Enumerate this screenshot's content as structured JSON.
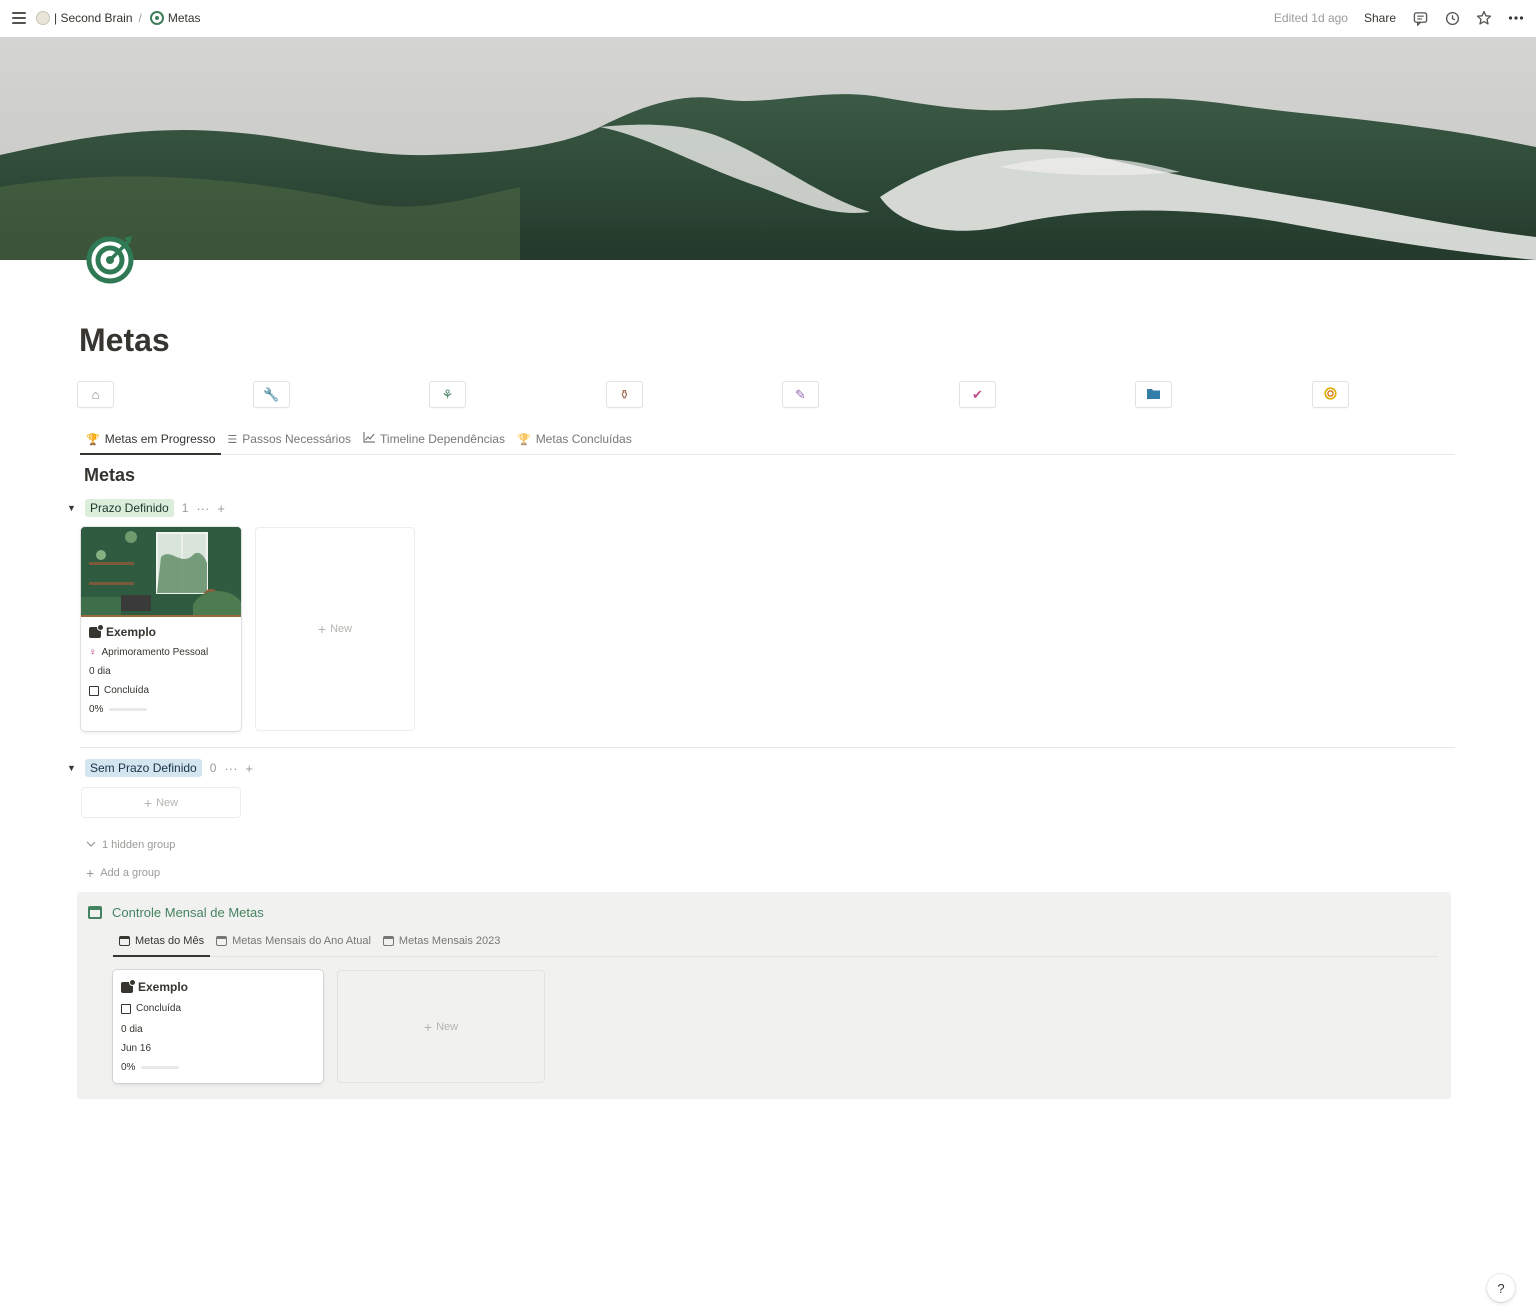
{
  "breadcrumb": {
    "workspace": "| Second Brain",
    "separator": "/",
    "page": "Metas"
  },
  "topbar": {
    "edited": "Edited 1d ago",
    "share": "Share"
  },
  "icons": {
    "menu": "menu-icon",
    "comments": "comment-icon",
    "history": "clock-icon",
    "favorite": "star-icon",
    "more": "more-icon"
  },
  "page": {
    "title": "Metas",
    "icon": "target-icon"
  },
  "nav_buttons": [
    {
      "icon": "home-icon",
      "glyph": "🏠",
      "color": "#8a8883"
    },
    {
      "icon": "wrench-icon",
      "glyph": "🔧",
      "color": "#d9730d"
    },
    {
      "icon": "plant-icon",
      "glyph": "🌷",
      "color": "#448361"
    },
    {
      "icon": "sprout-pot-icon",
      "glyph": "🪴",
      "color": "#9f6b53"
    },
    {
      "icon": "checklist-icon",
      "glyph": "✎",
      "color": "#9065b0"
    },
    {
      "icon": "badge-check-icon",
      "glyph": "✔",
      "color": "#c14c8a"
    },
    {
      "icon": "folder-icon",
      "glyph": "▬",
      "color": "#337ea9"
    },
    {
      "icon": "target-icon",
      "glyph": "◎",
      "color": "#dfab01"
    }
  ],
  "tabs": [
    {
      "label": "Metas em Progresso",
      "icon": "trophy-icon",
      "glyph": "🏆",
      "active": true
    },
    {
      "label": "Passos Necessários",
      "icon": "checklist-icon",
      "glyph": "☰",
      "active": false
    },
    {
      "label": "Timeline Dependências",
      "icon": "chart-line-icon",
      "glyph": "📈",
      "active": false
    },
    {
      "label": "Metas Concluídas",
      "icon": "trophy-icon",
      "glyph": "🏆",
      "active": false
    }
  ],
  "board": {
    "heading": "Metas",
    "groups": [
      {
        "label": "Prazo Definido",
        "count": "1"
      },
      {
        "label": "Sem Prazo Definido",
        "count": "0"
      }
    ],
    "card": {
      "title": "Exemplo",
      "area": "Aprimoramento Pessoal",
      "days": "0 dia",
      "done_label": "Concluída",
      "progress_text": "0%",
      "progress": 0
    },
    "new_label": "New",
    "hidden_groups": "1 hidden group",
    "add_group": "Add a group"
  },
  "callout": {
    "title": "Controle Mensal de Metas",
    "tabs": [
      {
        "label": "Metas do Mês",
        "active": true
      },
      {
        "label": "Metas Mensais do Ano Atual",
        "active": false
      },
      {
        "label": "Metas Mensais 2023",
        "active": false
      }
    ],
    "card": {
      "title": "Exemplo",
      "done_label": "Concluída",
      "days": "0 dia",
      "date": "Jun 16",
      "progress_text": "0%",
      "progress": 0
    },
    "new_label": "New"
  },
  "help": "?"
}
